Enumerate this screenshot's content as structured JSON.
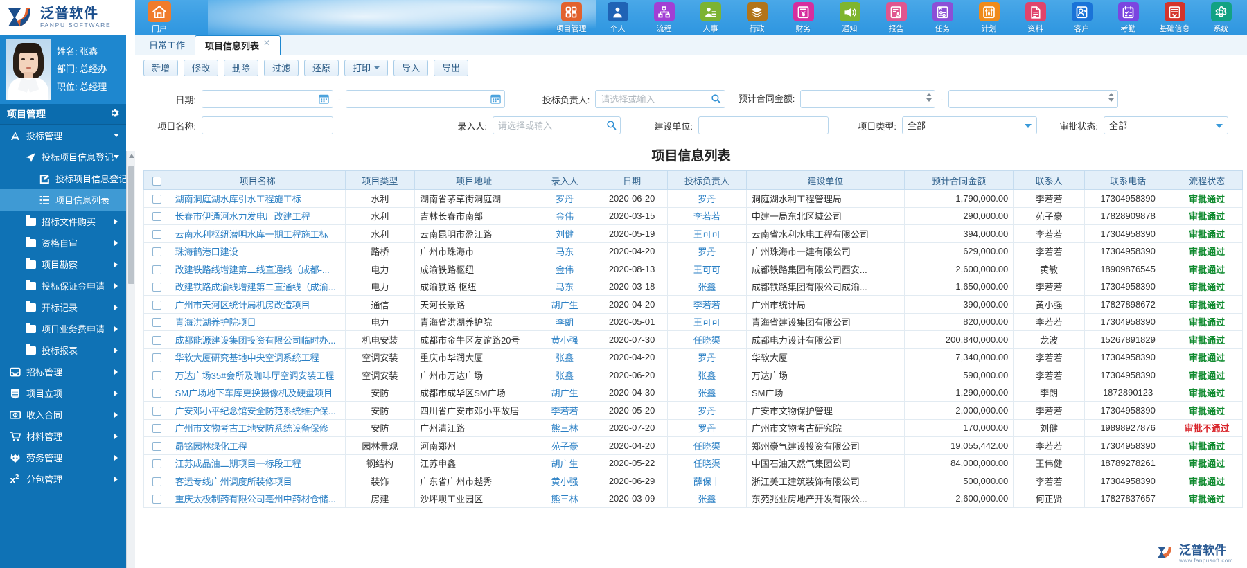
{
  "brand": {
    "cn": "泛普软件",
    "en": "FANPU SOFTWARE"
  },
  "home": {
    "label": "门户"
  },
  "topnav": [
    {
      "label": "项目管理",
      "icon": "grid-icon",
      "color": "#e2612c"
    },
    {
      "label": "个人",
      "icon": "person-icon",
      "color": "#1f63b5"
    },
    {
      "label": "流程",
      "icon": "sitemap-icon",
      "color": "#a23fd4"
    },
    {
      "label": "人事",
      "icon": "user-card-icon",
      "color": "#7cb332"
    },
    {
      "label": "行政",
      "icon": "layers-icon",
      "color": "#b2741a"
    },
    {
      "label": "财务",
      "icon": "yen-book-icon",
      "color": "#d62e9e"
    },
    {
      "label": "通知",
      "icon": "megaphone-icon",
      "color": "#7fb52e"
    },
    {
      "label": "报告",
      "icon": "report-mic-icon",
      "color": "#e0568f"
    },
    {
      "label": "任务",
      "icon": "task-slider-icon",
      "color": "#8c4fd6"
    },
    {
      "label": "计划",
      "icon": "equalizer-icon",
      "color": "#ef8b1b"
    },
    {
      "label": "资料",
      "icon": "document-icon",
      "color": "#e0446b"
    },
    {
      "label": "客户",
      "icon": "customer-icon",
      "color": "#1a73d8"
    },
    {
      "label": "考勤",
      "icon": "checklist-icon",
      "color": "#7b46e0"
    },
    {
      "label": "基础信息",
      "icon": "base-info-icon",
      "color": "#d4342b"
    },
    {
      "label": "系统",
      "icon": "gear-icon",
      "color": "#12a283"
    }
  ],
  "user": {
    "name_label": "姓名: 张鑫",
    "dept_label": "部门: 总经办",
    "title_label": "职位: 总经理"
  },
  "sidebar": {
    "section_title": "项目管理",
    "items": [
      {
        "label": "投标管理",
        "level": 1,
        "icon": "bid-icon",
        "arrow": "down",
        "active": false
      },
      {
        "label": "投标项目信息登记",
        "level": 2,
        "icon": "send-icon",
        "arrow": "down",
        "active": false
      },
      {
        "label": "投标项目信息登记",
        "level": 3,
        "icon": "edit-icon",
        "arrow": "none",
        "active": false
      },
      {
        "label": "项目信息列表",
        "level": 3,
        "icon": "list-icon",
        "arrow": "none",
        "active": true
      },
      {
        "label": "招标文件购买",
        "level": 2,
        "icon": "folder-icon",
        "arrow": "right",
        "active": false
      },
      {
        "label": "资格自审",
        "level": 2,
        "icon": "folder-icon",
        "arrow": "right",
        "active": false
      },
      {
        "label": "项目勘察",
        "level": 2,
        "icon": "folder-icon",
        "arrow": "right",
        "active": false
      },
      {
        "label": "投标保证金申请",
        "level": 2,
        "icon": "folder-icon",
        "arrow": "right",
        "active": false
      },
      {
        "label": "开标记录",
        "level": 2,
        "icon": "folder-icon",
        "arrow": "right",
        "active": false
      },
      {
        "label": "项目业务费申请",
        "level": 2,
        "icon": "folder-icon",
        "arrow": "right",
        "active": false
      },
      {
        "label": "投标报表",
        "level": 2,
        "icon": "folder-icon",
        "arrow": "right",
        "active": false
      },
      {
        "label": "招标管理",
        "level": 1,
        "icon": "inbox-icon",
        "arrow": "right",
        "active": false
      },
      {
        "label": "项目立项",
        "level": 1,
        "icon": "doclines-icon",
        "arrow": "right",
        "active": false
      },
      {
        "label": "收入合同",
        "level": 1,
        "icon": "money-icon",
        "arrow": "right",
        "active": false
      },
      {
        "label": "材料管理",
        "level": 1,
        "icon": "cart-icon",
        "arrow": "right",
        "active": false
      },
      {
        "label": "劳务管理",
        "level": 1,
        "icon": "labor-icon",
        "arrow": "right",
        "active": false
      },
      {
        "label": "分包管理",
        "level": 1,
        "icon": "x2-icon",
        "arrow": "right",
        "active": false
      }
    ]
  },
  "tabs": [
    {
      "label": "日常工作",
      "active": false,
      "closable": false
    },
    {
      "label": "项目信息列表",
      "active": true,
      "closable": true
    }
  ],
  "toolbar": [
    {
      "label": "新增",
      "name": "add-button"
    },
    {
      "label": "修改",
      "name": "edit-button"
    },
    {
      "label": "删除",
      "name": "delete-button"
    },
    {
      "label": "过滤",
      "name": "filter-button"
    },
    {
      "label": "还原",
      "name": "restore-button"
    },
    {
      "label": "打印",
      "name": "print-button",
      "dropdown": true
    },
    {
      "label": "导入",
      "name": "import-button"
    },
    {
      "label": "导出",
      "name": "export-button"
    }
  ],
  "filters": {
    "date_label": "日期:",
    "date_from": "",
    "date_to": "",
    "bid_owner_label": "投标负责人:",
    "bid_owner_value": "",
    "bid_owner_placeholder": "请选择或输入",
    "amount_label": "预计合同金额:",
    "amount_from": "",
    "amount_to": "",
    "project_name_label": "项目名称:",
    "project_name_value": "",
    "recorder_label": "录入人:",
    "recorder_value": "",
    "recorder_placeholder": "请选择或输入",
    "build_unit_label": "建设单位:",
    "build_unit_value": "",
    "project_type_label": "项目类型:",
    "project_type_value": "全部",
    "approval_label": "审批状态:",
    "approval_value": "全部",
    "select_options": [
      "全部"
    ]
  },
  "page_title": "项目信息列表",
  "table": {
    "columns": [
      "项目名称",
      "项目类型",
      "项目地址",
      "录入人",
      "日期",
      "投标负责人",
      "建设单位",
      "预计合同金额",
      "联系人",
      "联系电话",
      "流程状态"
    ],
    "rows": [
      {
        "name": "湖南洞庭湖水库引水工程施工标",
        "type": "水利",
        "addr": "湖南省茅草街洞庭湖",
        "recorder": "罗丹",
        "date": "2020-06-20",
        "owner": "罗丹",
        "unit": "洞庭湖水利工程管理局",
        "amount": "1,790,000.00",
        "contact": "李若若",
        "phone": "17304958390",
        "status": "审批通过",
        "status_ok": true
      },
      {
        "name": "长春市伊通河水力发电厂改建工程",
        "type": "水利",
        "addr": "吉林长春市南部",
        "recorder": "金伟",
        "date": "2020-03-15",
        "owner": "李若若",
        "unit": "中建一局东北区域公司",
        "amount": "290,000.00",
        "contact": "苑子豪",
        "phone": "17828909878",
        "status": "审批通过",
        "status_ok": true
      },
      {
        "name": "云南水利枢纽潜明水库一期工程施工标",
        "type": "水利",
        "addr": "云南昆明市盈江路",
        "recorder": "刘健",
        "date": "2020-05-19",
        "owner": "王可可",
        "unit": "云南省水利水电工程有限公司",
        "amount": "394,000.00",
        "contact": "李若若",
        "phone": "17304958390",
        "status": "审批通过",
        "status_ok": true
      },
      {
        "name": "珠海鹤港口建设",
        "type": "路桥",
        "addr": "广州市珠海市",
        "recorder": "马东",
        "date": "2020-04-20",
        "owner": "罗丹",
        "unit": "广州珠海市一建有限公司",
        "amount": "629,000.00",
        "contact": "李若若",
        "phone": "17304958390",
        "status": "审批通过",
        "status_ok": true
      },
      {
        "name": "改建铁路线增建第二线直通线（成都-...",
        "type": "电力",
        "addr": "成渝铁路枢纽",
        "recorder": "金伟",
        "date": "2020-08-13",
        "owner": "王可可",
        "unit": "成都铁路集团有限公司西安...",
        "amount": "2,600,000.00",
        "contact": "黄敏",
        "phone": "18909876545",
        "status": "审批通过",
        "status_ok": true
      },
      {
        "name": "改建铁路成渝线增建第二直通线（成渝...",
        "type": "电力",
        "addr": "成渝铁路 枢纽",
        "recorder": "马东",
        "date": "2020-03-18",
        "owner": "张鑫",
        "unit": "成都铁路集团有限公司成渝...",
        "amount": "1,650,000.00",
        "contact": "李若若",
        "phone": "17304958390",
        "status": "审批通过",
        "status_ok": true
      },
      {
        "name": "广州市天河区统计局机房改造项目",
        "type": "通信",
        "addr": "天河长景路",
        "recorder": "胡广生",
        "date": "2020-04-20",
        "owner": "李若若",
        "unit": "广州市统计局",
        "amount": "390,000.00",
        "contact": "黄小强",
        "phone": "17827898672",
        "status": "审批通过",
        "status_ok": true
      },
      {
        "name": "青海洪湖养护院项目",
        "type": "电力",
        "addr": "青海省洪湖养护院",
        "recorder": "李朗",
        "date": "2020-05-01",
        "owner": "王可可",
        "unit": "青海省建设集团有限公司",
        "amount": "820,000.00",
        "contact": "李若若",
        "phone": "17304958390",
        "status": "审批通过",
        "status_ok": true
      },
      {
        "name": "成都能源建设集团投资有限公司临时办...",
        "type": "机电安装",
        "addr": "成都市金牛区友谊路20号",
        "recorder": "黄小强",
        "date": "2020-07-30",
        "owner": "任晓渠",
        "unit": "成都电力设计有限公司",
        "amount": "200,840,000.00",
        "contact": "龙波",
        "phone": "15267891829",
        "status": "审批通过",
        "status_ok": true
      },
      {
        "name": "华软大厦研究基地中央空调系统工程",
        "type": "空调安装",
        "addr": "重庆市华润大厦",
        "recorder": "张鑫",
        "date": "2020-04-20",
        "owner": "罗丹",
        "unit": "华软大厦",
        "amount": "7,340,000.00",
        "contact": "李若若",
        "phone": "17304958390",
        "status": "审批通过",
        "status_ok": true
      },
      {
        "name": "万达广场35#会所及咖啡厅空调安装工程",
        "type": "空调安装",
        "addr": "广州市万达广场",
        "recorder": "张鑫",
        "date": "2020-06-20",
        "owner": "张鑫",
        "unit": "万达广场",
        "amount": "590,000.00",
        "contact": "李若若",
        "phone": "17304958390",
        "status": "审批通过",
        "status_ok": true
      },
      {
        "name": "SM广场地下车库更换摄像机及硬盘项目",
        "type": "安防",
        "addr": "成都市成华区SM广场",
        "recorder": "胡广生",
        "date": "2020-04-30",
        "owner": "张鑫",
        "unit": "SM广场",
        "amount": "1,290,000.00",
        "contact": "李朗",
        "phone": "1872890123",
        "status": "审批通过",
        "status_ok": true
      },
      {
        "name": "广安邓小平纪念馆安全防范系统维护保...",
        "type": "安防",
        "addr": "四川省广安市邓小平故居",
        "recorder": "李若若",
        "date": "2020-05-20",
        "owner": "罗丹",
        "unit": "广安市文物保护管理",
        "amount": "2,000,000.00",
        "contact": "李若若",
        "phone": "17304958390",
        "status": "审批通过",
        "status_ok": true
      },
      {
        "name": "广州市文物考古工地安防系统设备保修",
        "type": "安防",
        "addr": "广州清江路",
        "recorder": "熊三林",
        "date": "2020-07-20",
        "owner": "罗丹",
        "unit": "广州市文物考古研究院",
        "amount": "170,000.00",
        "contact": "刘健",
        "phone": "19898927876",
        "status": "审批不通过",
        "status_ok": false
      },
      {
        "name": "昴铭园林绿化工程",
        "type": "园林景观",
        "addr": "河南郑州",
        "recorder": "苑子豪",
        "date": "2020-04-20",
        "owner": "任晓渠",
        "unit": "郑州豪气建设投资有限公司",
        "amount": "19,055,442.00",
        "contact": "李若若",
        "phone": "17304958390",
        "status": "审批通过",
        "status_ok": true
      },
      {
        "name": "江苏成品油二期项目一标段工程",
        "type": "钢结构",
        "addr": "江苏申鑫",
        "recorder": "胡广生",
        "date": "2020-05-22",
        "owner": "任晓渠",
        "unit": "中国石油天然气集团公司",
        "amount": "84,000,000.00",
        "contact": "王伟健",
        "phone": "18789278261",
        "status": "审批通过",
        "status_ok": true
      },
      {
        "name": "客运专线广州调度所装修项目",
        "type": "装饰",
        "addr": "广东省广州市越秀",
        "recorder": "黄小强",
        "date": "2020-06-29",
        "owner": "薛保丰",
        "unit": "浙江美工建筑装饰有限公司",
        "amount": "500,000.00",
        "contact": "李若若",
        "phone": "17304958390",
        "status": "审批通过",
        "status_ok": true
      },
      {
        "name": "重庆太极制药有限公司亳州中药材仓储...",
        "type": "房建",
        "addr": "沙坪坝工业园区",
        "recorder": "熊三林",
        "date": "2020-03-09",
        "owner": "张鑫",
        "unit": "东苑兆业房地产开发有限公...",
        "amount": "2,600,000.00",
        "contact": "何正贤",
        "phone": "17827837657",
        "status": "审批通过",
        "status_ok": true
      }
    ]
  },
  "watermark": {
    "cn": "泛普软件",
    "en": "www.fanpusoft.com"
  }
}
